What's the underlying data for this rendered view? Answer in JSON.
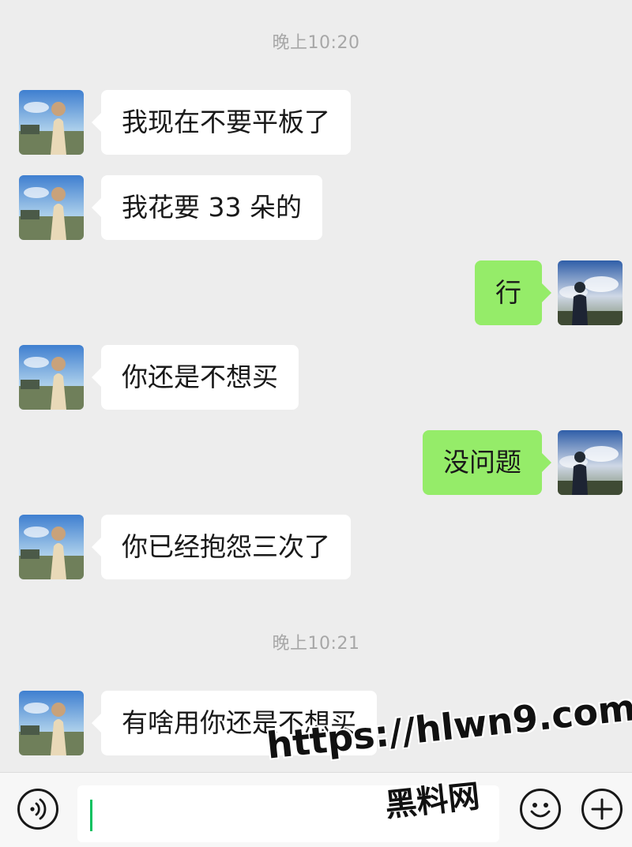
{
  "timestamps": [
    "晚上10:20",
    "晚上10:21"
  ],
  "messages": [
    {
      "side": "left",
      "text": "我现在不要平板了"
    },
    {
      "side": "left",
      "text": "我花要 33 朵的"
    },
    {
      "side": "right",
      "text": "行"
    },
    {
      "side": "left",
      "text": "你还是不想买"
    },
    {
      "side": "right",
      "text": "没问题"
    },
    {
      "side": "left",
      "text": "你已经抱怨三次了"
    },
    {
      "side": "left",
      "text": "有啥用你还是不想买"
    }
  ],
  "input": {
    "value": ""
  },
  "icons": {
    "voice": "voice-icon",
    "emoji": "emoji-icon",
    "more": "plus-icon"
  },
  "watermark": {
    "url": "https://hlwn9.com",
    "name": "黑料网"
  },
  "colors": {
    "background": "#ededed",
    "incoming_bubble": "#ffffff",
    "outgoing_bubble": "#95ec69",
    "timestamp_text": "#a7a7a7",
    "caret": "#07c160"
  }
}
